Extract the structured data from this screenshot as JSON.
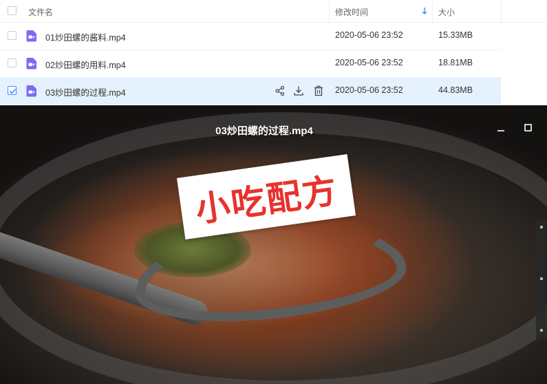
{
  "header": {
    "name_label": "文件名",
    "date_label": "修改时间",
    "size_label": "大小"
  },
  "files": [
    {
      "name": "01炒田螺的酱料.mp4",
      "date": "2020-05-06 23:52",
      "size": "15.33MB",
      "selected": false
    },
    {
      "name": "02炒田螺的用料.mp4",
      "date": "2020-05-06 23:52",
      "size": "18.81MB",
      "selected": false
    },
    {
      "name": "03炒田螺的过程.mp4",
      "date": "2020-05-06 23:52",
      "size": "44.83MB",
      "selected": true
    }
  ],
  "player": {
    "title": "03炒田螺的过程.mp4",
    "watermark": "小吃配方"
  },
  "icons": {
    "file_type": "video-file-icon",
    "share": "share-icon",
    "download": "download-icon",
    "delete": "trash-icon",
    "sort": "sort-down-arrow-icon",
    "minimize": "minimize-icon",
    "maximize": "maximize-icon"
  },
  "colors": {
    "selected_row": "#e5f2fd",
    "accent": "#3b8cff",
    "file_icon": "#7b6cf6",
    "watermark_text": "#e8322c"
  }
}
